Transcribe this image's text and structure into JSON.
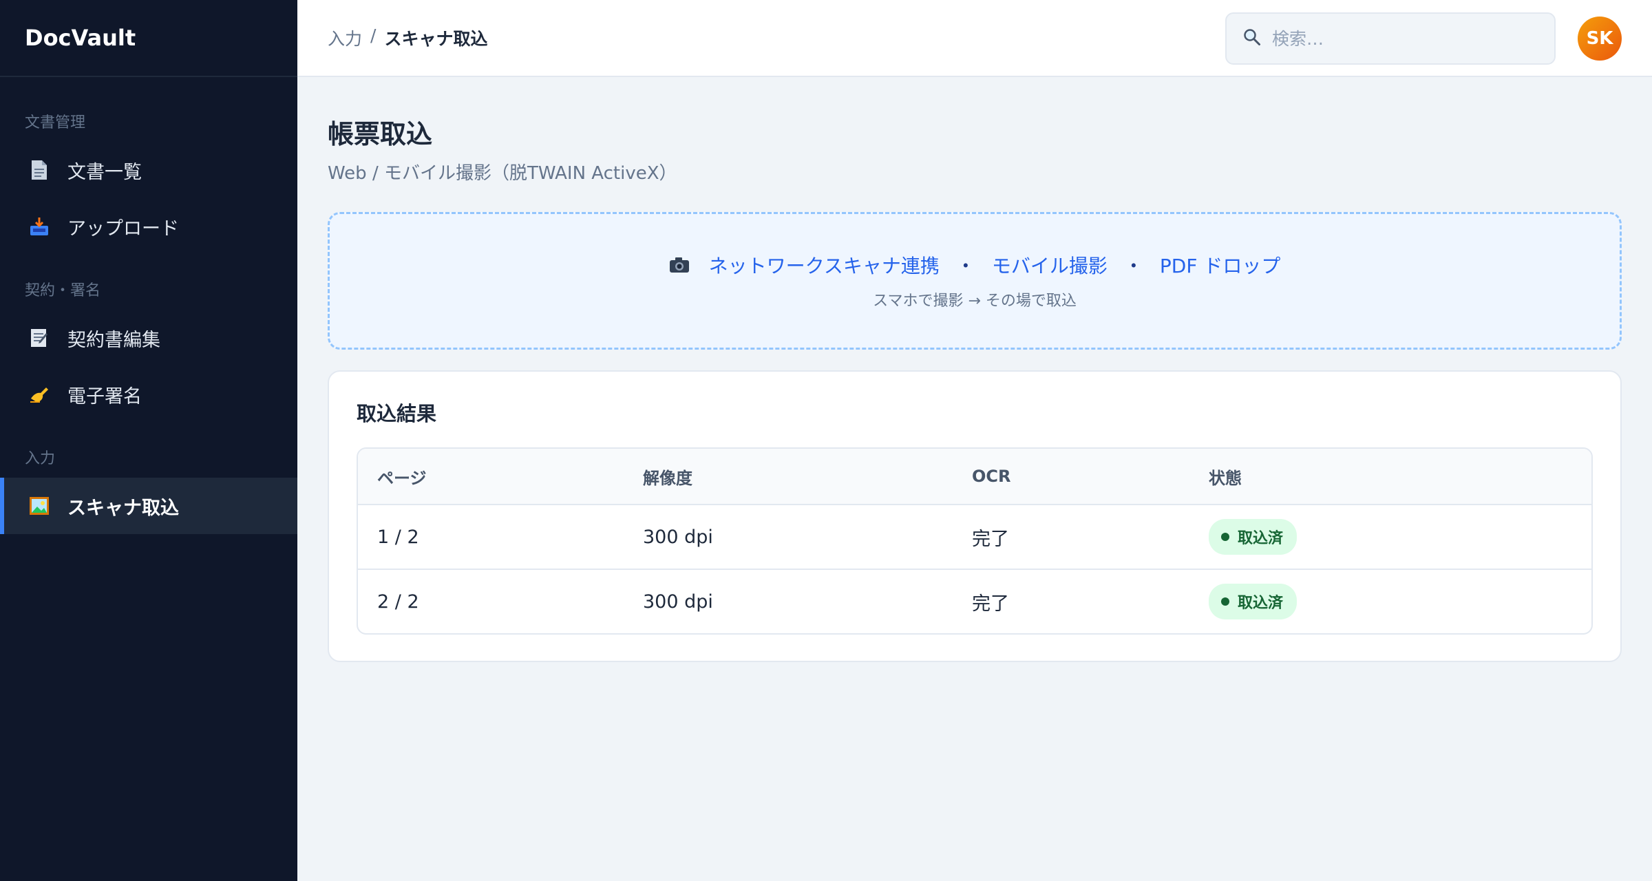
{
  "app": {
    "title": "DocVault"
  },
  "sidebar": {
    "sections": [
      {
        "label": "文書管理",
        "items": [
          {
            "label": "文書一覧",
            "icon": "document-icon"
          },
          {
            "label": "アップロード",
            "icon": "inbox-tray-icon"
          }
        ]
      },
      {
        "label": "契約・署名",
        "items": [
          {
            "label": "契約書編集",
            "icon": "memo-icon"
          },
          {
            "label": "電子署名",
            "icon": "writing-hand-icon"
          }
        ]
      },
      {
        "label": "入力",
        "items": [
          {
            "label": "スキャナ取込",
            "icon": "picture-icon",
            "active": true
          }
        ]
      }
    ]
  },
  "header": {
    "breadcrumb": {
      "parent": "入力",
      "separator": "/",
      "current": "スキャナ取込"
    },
    "search": {
      "placeholder": "検索…"
    },
    "avatar": {
      "initials": "SK"
    }
  },
  "main": {
    "title": "帳票取込",
    "subtitle": "Web / モバイル撮影（脱TWAIN ActiveX）",
    "dropzone": {
      "options": [
        "ネットワークスキャナ連携",
        "モバイル撮影",
        "PDF ドロップ"
      ],
      "separator": "・",
      "hint": "スマホで撮影 → その場で取込"
    },
    "results": {
      "title": "取込結果",
      "columns": [
        "ページ",
        "解像度",
        "OCR",
        "状態"
      ],
      "rows": [
        {
          "page": "1 / 2",
          "resolution": "300 dpi",
          "ocr": "完了",
          "status": "取込済"
        },
        {
          "page": "2 / 2",
          "resolution": "300 dpi",
          "ocr": "完了",
          "status": "取込済"
        }
      ]
    }
  },
  "colors": {
    "sidebar_bg": "#0f172a",
    "accent": "#3b82f6",
    "link": "#2563eb",
    "success_bg": "#dcfce7",
    "success_fg": "#166534"
  }
}
